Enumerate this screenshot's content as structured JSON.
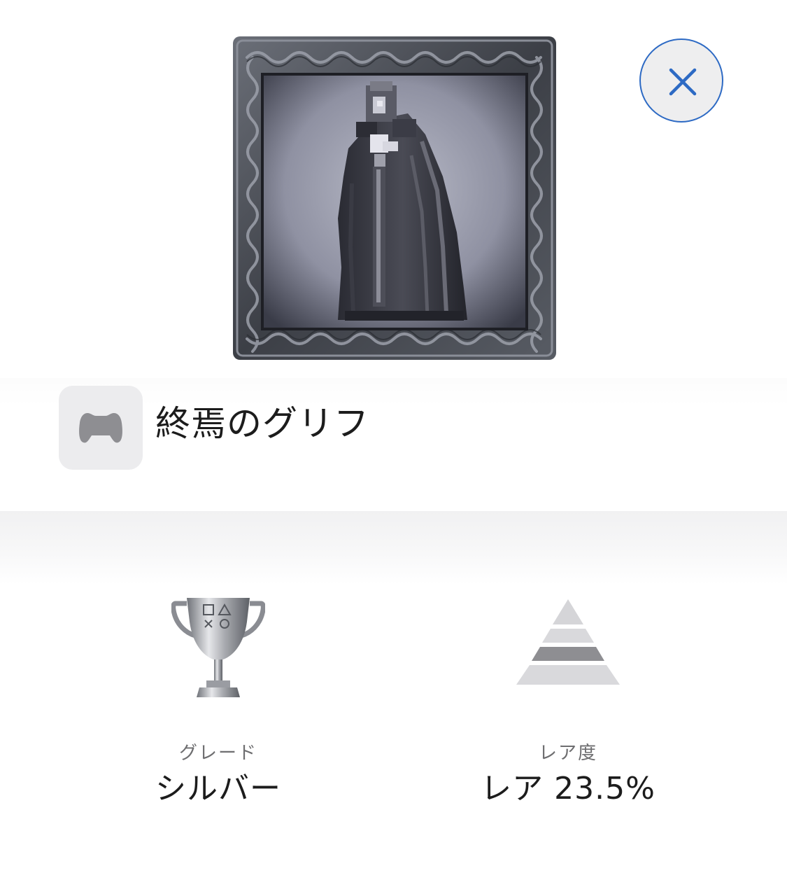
{
  "trophy": {
    "title": "終焉のグリフ",
    "artwork_icon": "vampire-portrait-icon"
  },
  "close_button": {
    "icon": "close-icon",
    "accent_color": "#2d6ac4"
  },
  "game_badge": {
    "icon": "gamepad-icon"
  },
  "grade": {
    "label": "グレード",
    "value": "シルバー",
    "icon": "silver-trophy-icon"
  },
  "rarity": {
    "label": "レア度",
    "value": "レア 23.5%",
    "icon": "rarity-pyramid-icon",
    "highlighted_tier": 3
  }
}
